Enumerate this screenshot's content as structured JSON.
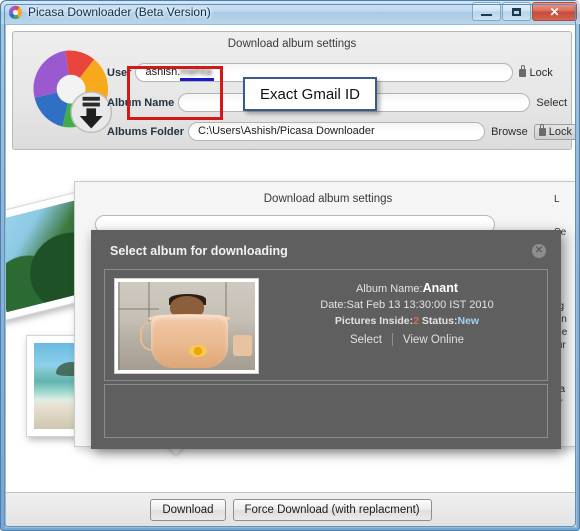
{
  "window": {
    "title": "Picasa Downloader (Beta Version)",
    "icon": "picasa-logo-icon",
    "minimize_label": "",
    "maximize_label": "",
    "close_label": "✕"
  },
  "settings": {
    "panel_title": "Download album settings",
    "fields": [
      {
        "label": "User",
        "value_visible": "ashish.",
        "value_redacted": "mehta",
        "action": "Lock",
        "action_icon": "lock-icon",
        "boxed": false
      },
      {
        "label": "Album Name",
        "value_visible": "",
        "value_redacted": "",
        "action": "Select",
        "action_icon": "",
        "boxed": false
      },
      {
        "label": "Albums Folder",
        "value_visible": "C:\\Users\\Ashish/Picasa Downloader",
        "value_redacted": "",
        "action": "Lock",
        "action_icon": "lock-icon",
        "action2": "Browse",
        "boxed": true
      }
    ]
  },
  "annotation": {
    "callout_text": "Exact Gmail ID",
    "highlight_color": "#d01a1a",
    "callout_border_color": "#3b5a8c"
  },
  "ghost_window": {
    "panel_title": "Download album settings",
    "clipped_text": [
      "L",
      "Se",
      "L",
      "lig",
      "sin",
      "ble",
      "tur",
      "l",
      "La",
      "ar"
    ]
  },
  "dialog": {
    "title": "Select album for downloading",
    "close_label": "✕",
    "album": {
      "name_label": "Album Name:",
      "name_value": "Anant",
      "date_label": "Date:",
      "date_value": "Sat Feb 13 13:30:00 IST 2010",
      "pictures_label": "Pictures Inside:",
      "pictures_value": "2",
      "status_label": "Status:",
      "status_value": "New",
      "status_color": "#9fd4f0",
      "count_color": "#d86a52",
      "select_label": "Select",
      "view_online_label": "View Online",
      "thumbnail_alt": "baby-in-bucket-photo"
    }
  },
  "footer": {
    "download_label": "Download",
    "force_download_label": "Force Download (with replacment)"
  }
}
